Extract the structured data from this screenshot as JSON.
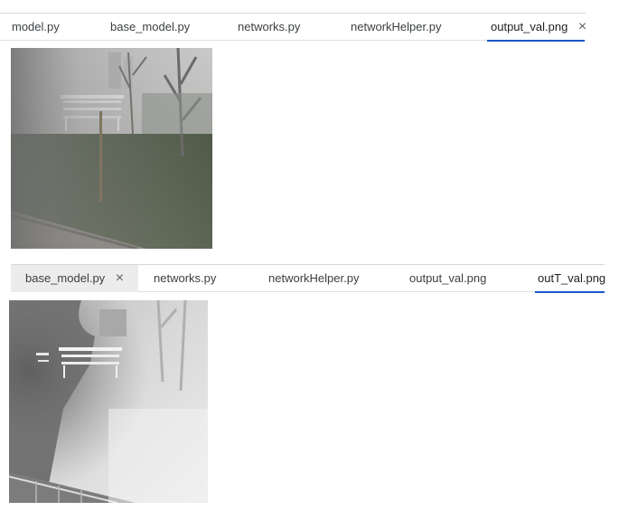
{
  "top_tabs": [
    {
      "label": "model.py"
    },
    {
      "label": "base_model.py"
    },
    {
      "label": "networks.py"
    },
    {
      "label": "networkHelper.py"
    },
    {
      "label": "output_val.png",
      "active": true,
      "closable": true
    }
  ],
  "bottom_tabs": [
    {
      "label": "base_model.py",
      "closable": true
    },
    {
      "label": "networks.py"
    },
    {
      "label": "networkHelper.py"
    },
    {
      "label": "output_val.png"
    },
    {
      "label": "outT_val.png",
      "active": true
    }
  ],
  "icons": {
    "close": "×"
  },
  "images": {
    "top": "output-val-image",
    "bottom": "outT-val-image"
  }
}
